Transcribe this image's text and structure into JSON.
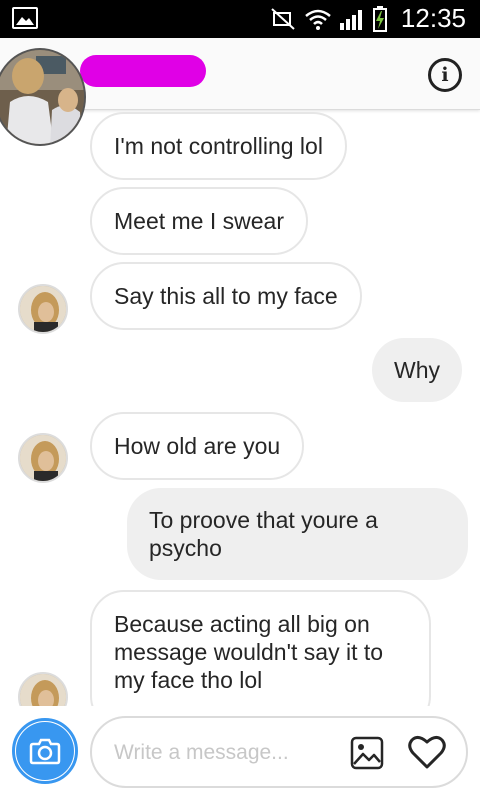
{
  "status_bar": {
    "time": "12:35",
    "icons": [
      "picture-icon",
      "mute-icon",
      "wifi-icon",
      "signal-icon",
      "battery-charging-icon"
    ]
  },
  "header": {
    "contact_name": "",
    "info_icon": "info-icon"
  },
  "messages": [
    {
      "direction": "received",
      "text": "I'm not controlling lol"
    },
    {
      "direction": "received",
      "text": "Meet me I swear"
    },
    {
      "direction": "received",
      "text": "Say this all to my face"
    },
    {
      "direction": "sent",
      "text": "Why"
    },
    {
      "direction": "received",
      "text": "How old are you"
    },
    {
      "direction": "sent",
      "text": "To proove that youre a psycho"
    },
    {
      "direction": "received",
      "text": "Because acting all big on message wouldn't say it to my face tho lol"
    }
  ],
  "composer": {
    "placeholder": "Write a message...",
    "camera_icon": "camera-icon",
    "gallery_icon": "gallery-icon",
    "like_icon": "heart-icon",
    "accent_color": "#3897f0"
  }
}
